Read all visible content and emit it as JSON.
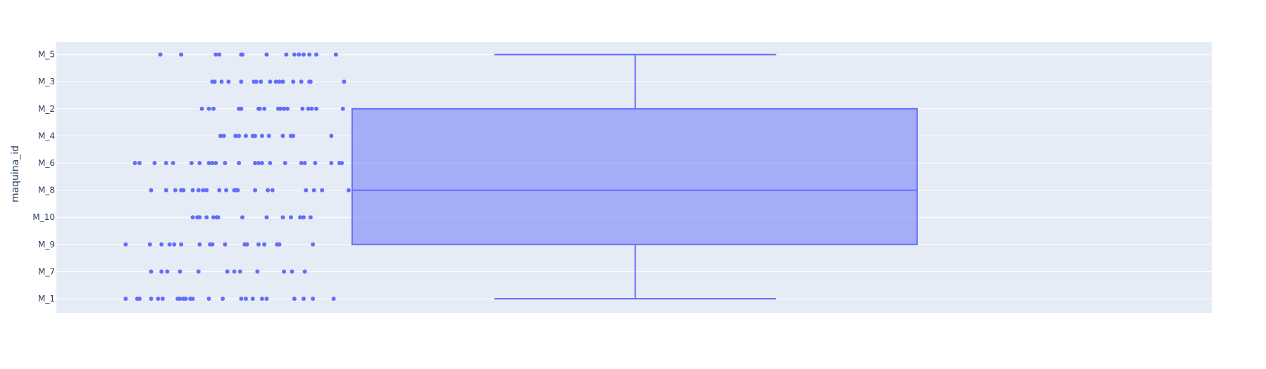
{
  "chart_data": {
    "type": "box",
    "orientation": "vertical-categories",
    "title": "",
    "xlabel": "",
    "ylabel": "maquina_id",
    "categories": [
      "M_1",
      "M_7",
      "M_9",
      "M_10",
      "M_8",
      "M_6",
      "M_4",
      "M_2",
      "M_3",
      "M_5"
    ],
    "box": {
      "category_range": [
        "M_1",
        "M_5"
      ],
      "lower_fence": "M_1",
      "q1": "M_9",
      "median": "M_8",
      "q3": "M_2",
      "upper_fence": "M_5"
    },
    "points": [
      {
        "category": "M_5",
        "x": [
          0.09,
          0.108,
          0.138,
          0.141,
          0.16,
          0.161,
          0.182,
          0.199,
          0.206,
          0.21,
          0.214,
          0.219,
          0.225,
          0.242
        ]
      },
      {
        "category": "M_3",
        "x": [
          0.135,
          0.137,
          0.143,
          0.149,
          0.16,
          0.171,
          0.173,
          0.177,
          0.185,
          0.19,
          0.193,
          0.196,
          0.205,
          0.212,
          0.219,
          0.22,
          0.249
        ]
      },
      {
        "category": "M_2",
        "x": [
          0.126,
          0.132,
          0.136,
          0.158,
          0.16,
          0.175,
          0.176,
          0.18,
          0.192,
          0.194,
          0.197,
          0.2,
          0.213,
          0.218,
          0.221,
          0.225,
          0.248
        ]
      },
      {
        "category": "M_4",
        "x": [
          0.142,
          0.145,
          0.155,
          0.158,
          0.164,
          0.17,
          0.172,
          0.178,
          0.184,
          0.196,
          0.203,
          0.205,
          0.238
        ]
      },
      {
        "category": "M_6",
        "x": [
          0.068,
          0.072,
          0.085,
          0.095,
          0.101,
          0.117,
          0.124,
          0.132,
          0.135,
          0.138,
          0.146,
          0.158,
          0.172,
          0.175,
          0.178,
          0.185,
          0.198,
          0.212,
          0.215,
          0.224,
          0.238,
          0.245,
          0.247
        ]
      },
      {
        "category": "M_8",
        "x": [
          0.082,
          0.095,
          0.103,
          0.108,
          0.11,
          0.118,
          0.123,
          0.127,
          0.13,
          0.141,
          0.147,
          0.154,
          0.156,
          0.157,
          0.172,
          0.183,
          0.187,
          0.216,
          0.223,
          0.23,
          0.253
        ]
      },
      {
        "category": "M_10",
        "x": [
          0.118,
          0.122,
          0.124,
          0.13,
          0.136,
          0.139,
          0.14,
          0.161,
          0.182,
          0.196,
          0.203,
          0.211,
          0.214,
          0.22
        ]
      },
      {
        "category": "M_9",
        "x": [
          0.06,
          0.081,
          0.091,
          0.098,
          0.102,
          0.108,
          0.124,
          0.133,
          0.135,
          0.146,
          0.163,
          0.165,
          0.175,
          0.18,
          0.191,
          0.193,
          0.222
        ]
      },
      {
        "category": "M_7",
        "x": [
          0.082,
          0.091,
          0.096,
          0.107,
          0.123,
          0.148,
          0.154,
          0.159,
          0.174,
          0.197,
          0.204,
          0.215
        ]
      },
      {
        "category": "M_1",
        "x": [
          0.06,
          0.07,
          0.072,
          0.082,
          0.088,
          0.092,
          0.105,
          0.107,
          0.11,
          0.112,
          0.116,
          0.118,
          0.132,
          0.144,
          0.16,
          0.164,
          0.17,
          0.178,
          0.182,
          0.206,
          0.214,
          0.222,
          0.24
        ]
      }
    ],
    "box_x_range": [
      0.256,
      0.745
    ],
    "whisker_x_range": [
      0.379,
      0.623
    ],
    "center_x": 0.501,
    "grid": true,
    "legend": "none",
    "colors": {
      "plot_bg": "#e5ecf6",
      "grid": "#ffffff",
      "marker": "#636efa",
      "box_fill": "rgba(99,110,250,0.5)",
      "box_line": "#636efa",
      "text": "#2a3f5f"
    }
  }
}
